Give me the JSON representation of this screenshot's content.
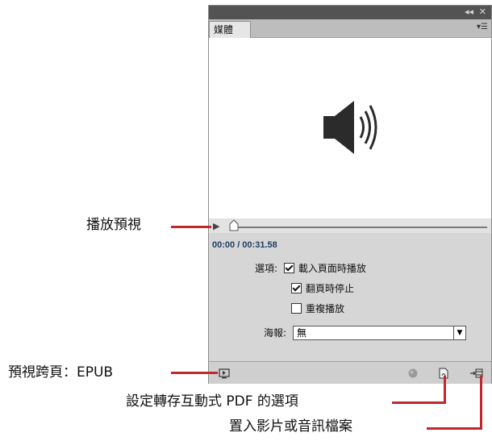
{
  "panel": {
    "tab_label": "媒體",
    "collapse_icon": "double-chevron-left-icon",
    "close_icon": "close-icon",
    "menu_icon": "panel-menu-icon",
    "preview_icon": "speaker-icon"
  },
  "player": {
    "play_icon": "play-icon",
    "time": "00:00 / 00:31.58"
  },
  "options": {
    "label": "選項:",
    "autoplay_label": "載入頁面時播放",
    "autoplay_checked": true,
    "stop_on_turn_label": "翻頁時停止",
    "stop_on_turn_checked": true,
    "loop_label": "重複播放",
    "loop_checked": false
  },
  "poster": {
    "label": "海報:",
    "value": "無"
  },
  "callouts": {
    "play_preview": "播放預視",
    "preview_spread": "預視跨頁：EPUB",
    "interactive_pdf": "設定轉存互動式 PDF 的選項",
    "place_media": "置入影片或音訊檔案"
  },
  "colors": {
    "callout_line": "#c0282d",
    "time_text": "#1d3f63"
  }
}
